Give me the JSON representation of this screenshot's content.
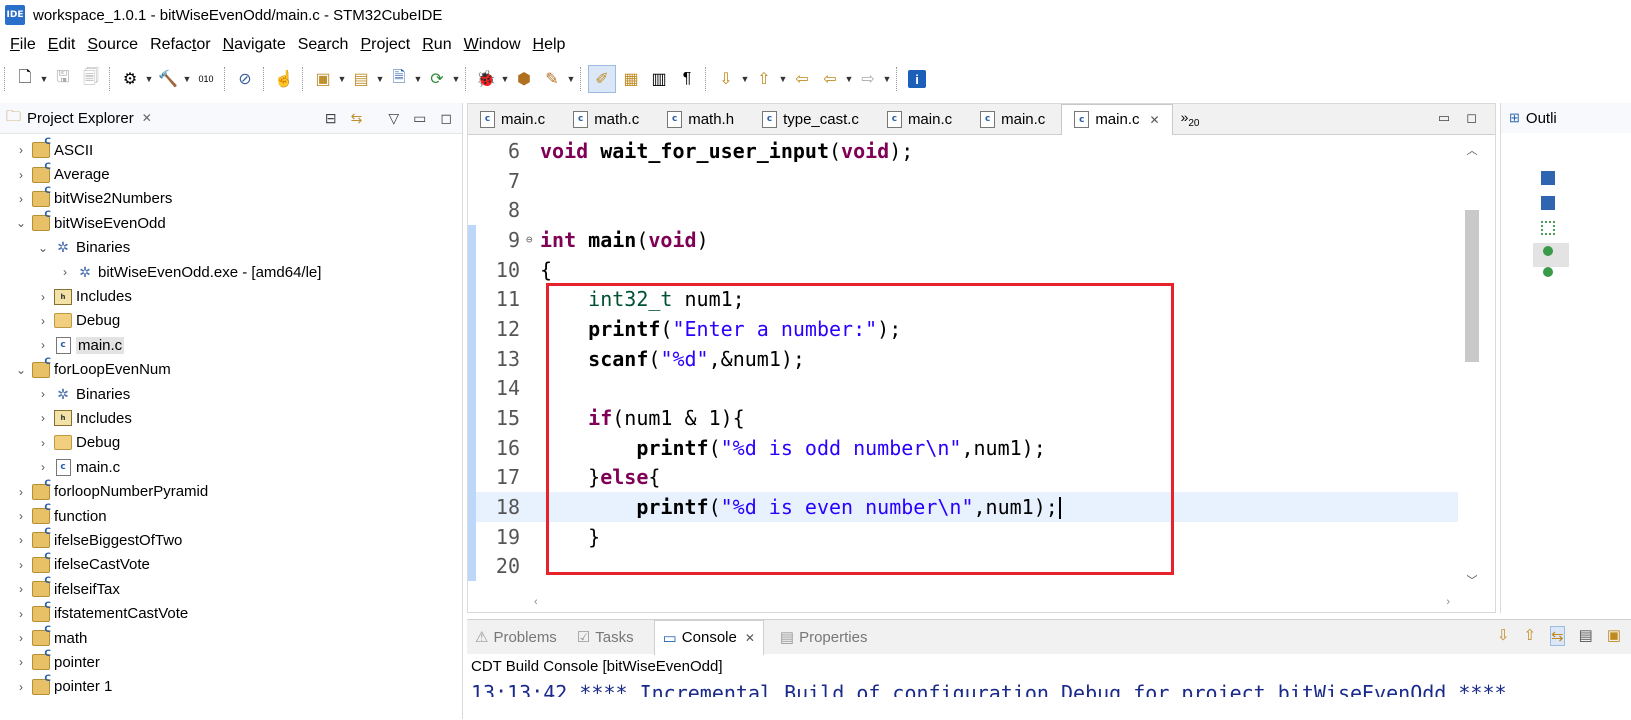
{
  "window": {
    "logo": "IDE",
    "title": "workspace_1.0.1 - bitWiseEvenOdd/main.c - STM32CubeIDE"
  },
  "menu": [
    {
      "u": "F",
      "rest": "ile"
    },
    {
      "u": "E",
      "rest": "dit"
    },
    {
      "u": "S",
      "rest": "ource"
    },
    {
      "pre": "Refac",
      "u": "t",
      "rest": "or"
    },
    {
      "u": "N",
      "rest": "avigate"
    },
    {
      "pre": "Se",
      "u": "a",
      "rest": "rch"
    },
    {
      "u": "P",
      "rest": "roject"
    },
    {
      "u": "R",
      "rest": "un"
    },
    {
      "u": "W",
      "rest": "indow"
    },
    {
      "u": "H",
      "rest": "elp"
    }
  ],
  "explorer": {
    "title": "Project Explorer",
    "tree": [
      {
        "label": "ASCII",
        "icon": "project-icon",
        "caret": "›",
        "indent": 0
      },
      {
        "label": "Average",
        "icon": "project-icon",
        "caret": "›",
        "indent": 0
      },
      {
        "label": "bitWise2Numbers",
        "icon": "project-icon",
        "caret": "›",
        "indent": 0
      },
      {
        "label": "bitWiseEvenOdd",
        "icon": "project-icon",
        "caret": "⌄",
        "indent": 0
      },
      {
        "label": "Binaries",
        "icon": "binaries-icon",
        "caret": "⌄",
        "indent": 1
      },
      {
        "label": "bitWiseEvenOdd.exe - [amd64/le]",
        "icon": "executable-icon",
        "caret": "›",
        "indent": 2
      },
      {
        "label": "Includes",
        "icon": "includes-icon",
        "caret": "›",
        "indent": 1
      },
      {
        "label": "Debug",
        "icon": "folder-icon",
        "caret": "›",
        "indent": 1
      },
      {
        "label": "main.c",
        "icon": "c-file-icon",
        "caret": "›",
        "indent": 1,
        "selected": true
      },
      {
        "label": "forLoopEvenNum",
        "icon": "project-icon",
        "caret": "⌄",
        "indent": 0
      },
      {
        "label": "Binaries",
        "icon": "binaries-icon",
        "caret": "›",
        "indent": 1
      },
      {
        "label": "Includes",
        "icon": "includes-icon",
        "caret": "›",
        "indent": 1
      },
      {
        "label": "Debug",
        "icon": "folder-icon",
        "caret": "›",
        "indent": 1
      },
      {
        "label": "main.c",
        "icon": "c-file-icon",
        "caret": "›",
        "indent": 1
      },
      {
        "label": "forloopNumberPyramid",
        "icon": "project-icon",
        "caret": "›",
        "indent": 0
      },
      {
        "label": "function",
        "icon": "project-icon",
        "caret": "›",
        "indent": 0
      },
      {
        "label": "ifelseBiggestOfTwo",
        "icon": "project-icon",
        "caret": "›",
        "indent": 0
      },
      {
        "label": "ifelseCastVote",
        "icon": "project-icon",
        "caret": "›",
        "indent": 0
      },
      {
        "label": "ifelseifTax",
        "icon": "project-icon",
        "caret": "›",
        "indent": 0
      },
      {
        "label": "ifstatementCastVote",
        "icon": "project-icon",
        "caret": "›",
        "indent": 0
      },
      {
        "label": "math",
        "icon": "project-icon",
        "caret": "›",
        "indent": 0
      },
      {
        "label": "pointer",
        "icon": "project-icon",
        "caret": "›",
        "indent": 0
      },
      {
        "label": "pointer 1",
        "icon": "project-icon",
        "caret": "›",
        "indent": 0
      }
    ]
  },
  "editor": {
    "tabs": [
      {
        "label": "main.c",
        "active": false
      },
      {
        "label": "math.c",
        "active": false
      },
      {
        "label": "math.h",
        "active": false
      },
      {
        "label": "type_cast.c",
        "active": false
      },
      {
        "label": "main.c",
        "active": false
      },
      {
        "label": "main.c",
        "active": false
      },
      {
        "label": "main.c",
        "active": true
      }
    ],
    "overflow": "»",
    "overflow_count": "20",
    "lines": [
      {
        "n": "6",
        "tokens": [
          [
            "kw",
            "void"
          ],
          [
            "",
            " "
          ],
          [
            "fn",
            "wait_for_user_input"
          ],
          [
            "",
            "("
          ],
          [
            "kw",
            "void"
          ],
          [
            "",
            ");"
          ]
        ]
      },
      {
        "n": "7",
        "tokens": []
      },
      {
        "n": "8",
        "tokens": []
      },
      {
        "n": "9",
        "fold": "⊖",
        "tokens": [
          [
            "kw",
            "int"
          ],
          [
            "",
            " "
          ],
          [
            "fn",
            "main"
          ],
          [
            "",
            "("
          ],
          [
            "kw",
            "void"
          ],
          [
            "",
            ")"
          ]
        ]
      },
      {
        "n": "10",
        "tokens": [
          [
            "",
            "{"
          ]
        ]
      },
      {
        "n": "11",
        "tokens": [
          [
            "",
            "    "
          ],
          [
            "ty",
            "int32_t"
          ],
          [
            "",
            " num1;"
          ]
        ]
      },
      {
        "n": "12",
        "tokens": [
          [
            "",
            "    "
          ],
          [
            "fn",
            "printf"
          ],
          [
            "",
            "("
          ],
          [
            "str",
            "\"Enter a number:\""
          ],
          [
            "",
            ");"
          ]
        ]
      },
      {
        "n": "13",
        "tokens": [
          [
            "",
            "    "
          ],
          [
            "fn",
            "scanf"
          ],
          [
            "",
            "("
          ],
          [
            "str",
            "\"%d\""
          ],
          [
            "",
            ",&num1);"
          ]
        ]
      },
      {
        "n": "14",
        "tokens": []
      },
      {
        "n": "15",
        "tokens": [
          [
            "",
            "    "
          ],
          [
            "kw",
            "if"
          ],
          [
            "",
            "(num1 & 1){"
          ]
        ]
      },
      {
        "n": "16",
        "tokens": [
          [
            "",
            "        "
          ],
          [
            "fn",
            "printf"
          ],
          [
            "",
            "("
          ],
          [
            "str",
            "\"%d is odd number\\n\""
          ],
          [
            "",
            ",num1);"
          ]
        ]
      },
      {
        "n": "17",
        "tokens": [
          [
            "",
            "    }"
          ],
          [
            "kw",
            "else"
          ],
          [
            "",
            "{"
          ]
        ]
      },
      {
        "n": "18",
        "current": true,
        "tokens": [
          [
            "",
            "        "
          ],
          [
            "fn",
            "printf"
          ],
          [
            "",
            "("
          ],
          [
            "str",
            "\"%d is even number\\n\""
          ],
          [
            "",
            ",num1);"
          ]
        ]
      },
      {
        "n": "19",
        "tokens": [
          [
            "",
            "    }"
          ]
        ]
      },
      {
        "n": "20",
        "tokens": []
      }
    ]
  },
  "outline": {
    "title": "Outli"
  },
  "console": {
    "tabs": [
      {
        "label": "Problems",
        "active": false
      },
      {
        "label": "Tasks",
        "active": false
      },
      {
        "label": "Console",
        "active": true
      },
      {
        "label": "Properties",
        "active": false
      }
    ],
    "label": "CDT Build Console [bitWiseEvenOdd]",
    "output": "13:13:42 **** Incremental Build of configuration Debug for project bitWiseEvenOdd ****"
  }
}
